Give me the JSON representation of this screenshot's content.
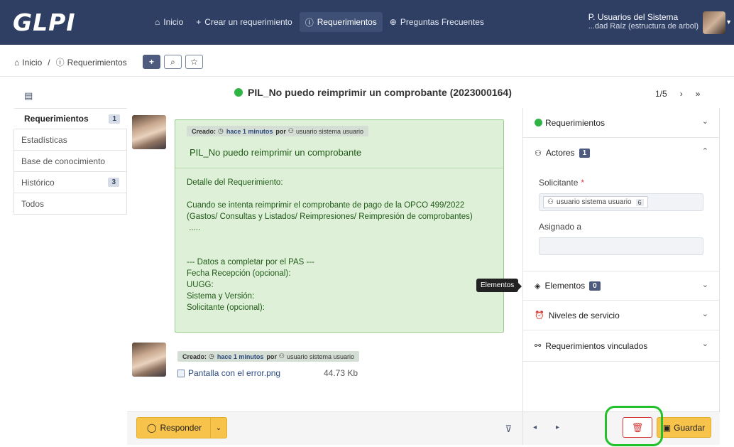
{
  "topbar": {
    "logo": "GLPI",
    "nav": [
      {
        "icon": "home-icon",
        "glyph": "⌂",
        "label": "Inicio"
      },
      {
        "icon": "plus-icon",
        "glyph": "+",
        "label": "Crear un requerimiento"
      },
      {
        "icon": "alert-circle-icon",
        "glyph": "ⓘ",
        "label": "Requerimientos"
      },
      {
        "icon": "lifebuoy-icon",
        "glyph": "⊕",
        "label": "Preguntas Frecuentes"
      }
    ],
    "user_profile": "P. Usuarios del Sistema",
    "user_entity": "...dad Raíz (estructura de arbol)"
  },
  "breadcrumb": {
    "home": "Inicio",
    "sep": "/",
    "current": "Requerimientos"
  },
  "ticket": {
    "title": "PIL_No puedo reimprimir un comprobante (2023000164)",
    "status_color": "#2fb344",
    "pager": "1/5"
  },
  "leftnav": [
    {
      "label": "Requerimientos",
      "badge": "1"
    },
    {
      "label": "Estadísticas",
      "badge": ""
    },
    {
      "label": "Base de conocimiento",
      "badge": ""
    },
    {
      "label": "Histórico",
      "badge": "3"
    },
    {
      "label": "Todos",
      "badge": ""
    }
  ],
  "timeline": {
    "item1": {
      "created_label": "Creado:",
      "time": "hace 1 minutos",
      "by": "por",
      "user": "usuario sistema usuario",
      "title": "PIL_No puedo reimprimir un comprobante",
      "body": "Detalle del Requerimiento:\n\nCuando se intenta reimprimir el comprobante de pago de la OPCO 499/2022\n(Gastos/ Consultas y Listados/ Reimpresiones/ Reimpresión de comprobantes)\n .....\n\n\n--- Datos a completar por el PAS ---\nFecha Recepción (opcional):\nUUGG:\nSistema y Versión:\nSolicitante (opcional):"
    },
    "item2": {
      "created_label": "Creado:",
      "time": "hace 1 minutos",
      "by": "por",
      "user": "usuario sistema usuario",
      "file": "Pantalla con el error.png",
      "size": "44.73 Kb"
    }
  },
  "tooltip": "Elementos",
  "footer": {
    "reply": "Responder",
    "save": "Guardar"
  },
  "rightpanel": {
    "ticket_section": "Requerimientos",
    "actors": "Actores",
    "actors_count": "1",
    "requester_label": "Solicitante",
    "required_mark": "*",
    "requester_value": "usuario sistema usuario",
    "requester_count": "6",
    "assigned_label": "Asignado a",
    "items": "Elementos",
    "items_count": "0",
    "sla": "Niveles de servicio",
    "linked": "Requerimientos vinculados"
  }
}
